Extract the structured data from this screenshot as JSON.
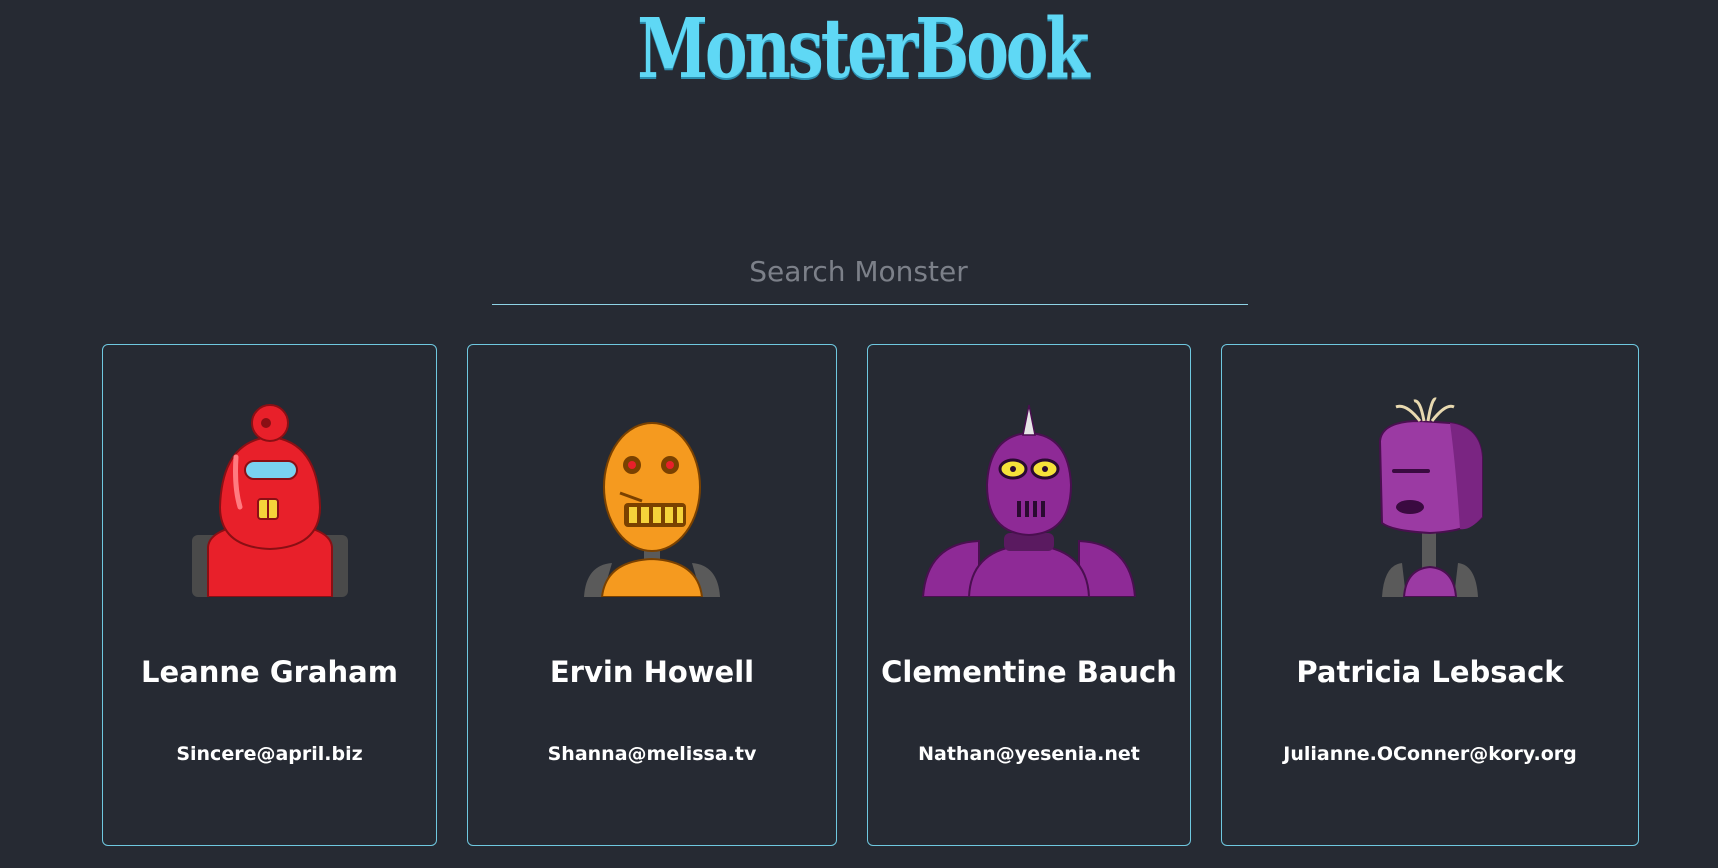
{
  "header": {
    "logo_text": "MonsterBook"
  },
  "search": {
    "placeholder": "Search Monster",
    "value": ""
  },
  "monsters": [
    {
      "name": "Leanne Graham",
      "email": "Sincere@april.biz",
      "color": "#e8202a",
      "icon": "red-robot-avatar"
    },
    {
      "name": "Ervin Howell",
      "email": "Shanna@melissa.tv",
      "color": "#f59a1f",
      "icon": "orange-robot-avatar"
    },
    {
      "name": "Clementine Bauch",
      "email": "Nathan@yesenia.net",
      "color": "#8e2a96",
      "icon": "purple-robot-avatar"
    },
    {
      "name": "Patricia Lebsack",
      "email": "Julianne.OConner@kory.org",
      "color": "#9b3aa3",
      "icon": "purple-robot-avatar"
    }
  ],
  "colors": {
    "background": "#262a33",
    "accent": "#5fd8f5",
    "card_border": "#6fc8e0"
  }
}
